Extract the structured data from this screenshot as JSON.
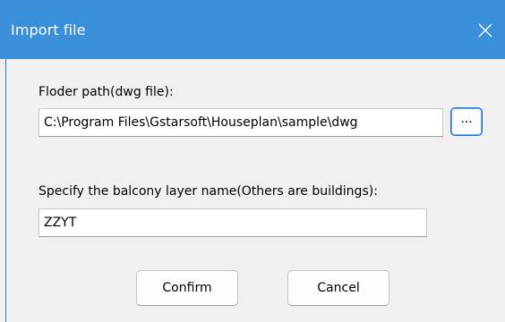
{
  "window": {
    "title": "Import file"
  },
  "icons": {
    "close": "close-icon"
  },
  "form": {
    "folder_label": "Floder path(dwg file):",
    "folder_value": "C:\\Program Files\\Gstarsoft\\Houseplan\\sample\\dwg",
    "browse_label": "...",
    "layer_label": "Specify the balcony layer name(Others are buildings):",
    "layer_value": "ZZYT"
  },
  "buttons": {
    "confirm": "Confirm",
    "cancel": "Cancel"
  },
  "colors": {
    "titlebar": "#3b8fd9",
    "dialog_background": "#f0f0f0",
    "focus_border": "#1a6fd6"
  }
}
